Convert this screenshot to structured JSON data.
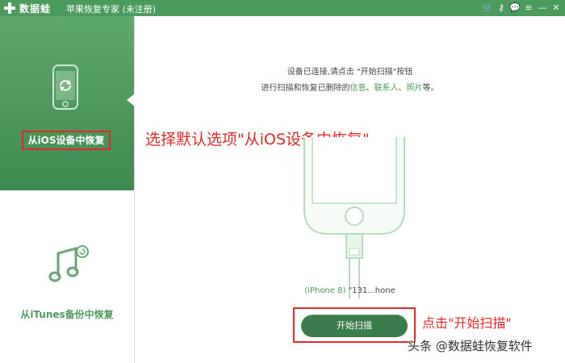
{
  "titlebar": {
    "app_name": "数据蛙",
    "window_title": "苹果恢复专家 (未注册)",
    "icons": [
      "cart-icon",
      "key-icon",
      "chat-icon",
      "menu-icon",
      "minimize-icon",
      "close-icon"
    ],
    "icon_glyphs": [
      "🛒",
      "⚷",
      "💬",
      "≡",
      "—",
      "✕"
    ]
  },
  "sidebar": {
    "active_mode_label": "从iOS设备中恢复",
    "itunes_mode_label": "从iTunes备份中恢复"
  },
  "main": {
    "message_line1": "设备已连接,请点击 \"开始扫描\"按钮",
    "message_line2_prefix": "进行扫描和恢复已删除的",
    "link_messages": "信息",
    "sep1": "、",
    "link_contacts": "联系人",
    "sep2": "、",
    "link_photos": "照片",
    "message_line2_suffix": "等。",
    "device_model": "(iPhone 8)",
    "device_name": "\"131...hone",
    "scan_button_label": "开始扫描"
  },
  "annotations": {
    "select_default": "选择默认选项\"从iOS设备中恢复\"",
    "click_scan": "点击\"开始扫描\""
  },
  "watermark": "头条 @数据蛙恢复软件",
  "colors": {
    "brand_green": "#4c9a5c",
    "button_green": "#3b7d4a",
    "annotation_red": "#e02a2a"
  }
}
